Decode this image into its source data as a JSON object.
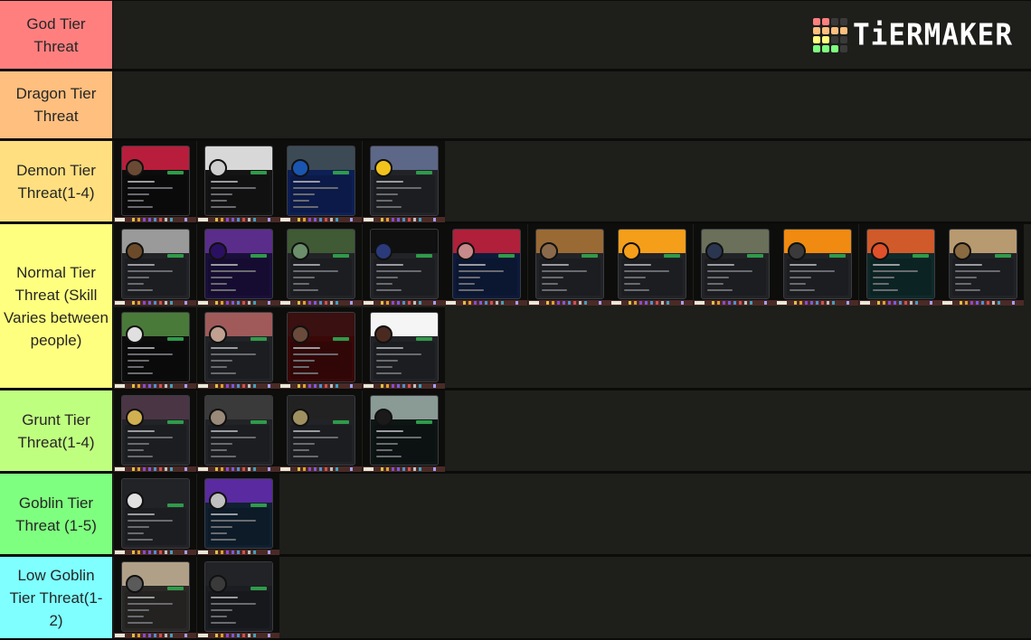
{
  "brand": {
    "logo_text": "TiERMAKER",
    "logo_grid_colors": [
      [
        "#ff7f7f",
        "#ff7f7f",
        "#3a3a3a",
        "#3a3a3a"
      ],
      [
        "#ffbf7f",
        "#ffbf7f",
        "#ffbf7f",
        "#ffbf7f"
      ],
      [
        "#ffff7f",
        "#ffff7f",
        "#3a3a3a",
        "#3a3a3a"
      ],
      [
        "#7fff7f",
        "#7fff7f",
        "#7fff7f",
        "#3a3a3a"
      ]
    ]
  },
  "tiers": [
    {
      "label": "God Tier Threat",
      "color": "#ff7f7f",
      "items": []
    },
    {
      "label": "Dragon Tier Threat",
      "color": "#ffbf7f",
      "items": []
    },
    {
      "label": "Demon Tier Threat(1-4)",
      "color": "#ffdf7f",
      "items": [
        {
          "name": "profile-card",
          "banner": "#b81e3c",
          "avatar": "#6b4a35",
          "theme": "#0c0c0c"
        },
        {
          "name": "profile-card",
          "banner": "#d8d8d8",
          "avatar": "#cfcfcf",
          "theme": "#141414"
        },
        {
          "name": "profile-card",
          "banner": "#3c4a55",
          "avatar": "#1a55b0",
          "theme": "#0d1f55"
        },
        {
          "name": "profile-card",
          "banner": "#5d6788",
          "avatar": "#f2c31d",
          "theme": "#222327"
        }
      ]
    },
    {
      "label": "Normal Tier Threat (Skill Varies between people)",
      "color": "#ffff7f",
      "items": [
        {
          "name": "profile-card",
          "banner": "#9a9a9a",
          "avatar": "#6b4a2a",
          "theme": "#222327"
        },
        {
          "name": "profile-card",
          "banner": "#5a2d8a",
          "avatar": "#2a1060",
          "theme": "#1a0f3a"
        },
        {
          "name": "profile-card",
          "banner": "#3f5a35",
          "avatar": "#6a8f6a",
          "theme": "#222327"
        },
        {
          "name": "profile-card",
          "banner": "#101010",
          "avatar": "#2a3a7a",
          "theme": "#222327"
        },
        {
          "name": "profile-card",
          "banner": "#b0203a",
          "avatar": "#c88a8a",
          "theme": "#0e1a3a"
        },
        {
          "name": "profile-card",
          "banner": "#9a6a35",
          "avatar": "#8a6a4a",
          "theme": "#222327"
        },
        {
          "name": "profile-card",
          "banner": "#f59e1a",
          "avatar": "#f59e1a",
          "theme": "#222327"
        },
        {
          "name": "profile-card",
          "banner": "#6a705a",
          "avatar": "#2a3550",
          "theme": "#222327"
        },
        {
          "name": "profile-card",
          "banner": "#f08a10",
          "avatar": "#3a3a3a",
          "theme": "#222327"
        },
        {
          "name": "profile-card",
          "banner": "#d05a2a",
          "avatar": "#e0502a",
          "theme": "#0f2a2a"
        },
        {
          "name": "profile-card",
          "banner": "#b89a70",
          "avatar": "#8a6a40",
          "theme": "#222327"
        },
        {
          "name": "profile-card",
          "banner": "#4a7a3a",
          "avatar": "#e0e0e0",
          "theme": "#0c0c0c"
        },
        {
          "name": "profile-card",
          "banner": "#a05a5a",
          "avatar": "#c0a090",
          "theme": "#222327"
        },
        {
          "name": "profile-card",
          "banner": "#3a1010",
          "avatar": "#6a4a3a",
          "theme": "#3a0808"
        },
        {
          "name": "profile-card",
          "banner": "#f5f5f5",
          "avatar": "#4a2a20",
          "theme": "#222327"
        }
      ]
    },
    {
      "label": "Grunt Tier Threat(1-4)",
      "color": "#bfff7f",
      "items": [
        {
          "name": "profile-card",
          "banner": "#4a3545",
          "avatar": "#d0b050",
          "theme": "#222327"
        },
        {
          "name": "profile-card",
          "banner": "#3a3a3a",
          "avatar": "#9a8a7a",
          "theme": "#222327"
        },
        {
          "name": "profile-card",
          "banner": "#222222",
          "avatar": "#a09060",
          "theme": "#222327"
        },
        {
          "name": "profile-card",
          "banner": "#8a9a95",
          "avatar": "#1a1a1a",
          "theme": "#0e1614"
        }
      ]
    },
    {
      "label": "Goblin Tier Threat (1-5)",
      "color": "#7fff7f",
      "items": [
        {
          "name": "profile-card",
          "banner": "#222327",
          "avatar": "#e0e0e0",
          "theme": "#222327"
        },
        {
          "name": "profile-card",
          "banner": "#5a2aa0",
          "avatar": "#c0c0c0",
          "theme": "#102030"
        }
      ]
    },
    {
      "label": "Low Goblin Tier Threat(1-2)",
      "color": "#7fffff",
      "items": [
        {
          "name": "profile-card",
          "banner": "#b0a088",
          "avatar": "#5a5a5a",
          "theme": "#2a2826"
        },
        {
          "name": "profile-card",
          "banner": "#222327",
          "avatar": "#3a3a3a",
          "theme": "#1c1d22"
        }
      ]
    }
  ]
}
